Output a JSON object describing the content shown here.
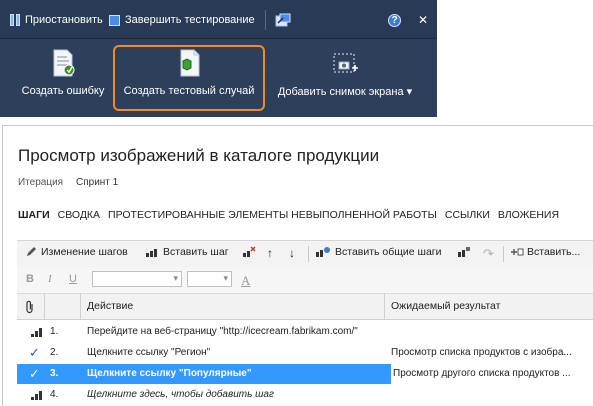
{
  "runner": {
    "pause_label": "Приостановить",
    "end_label": "Завершить тестирование",
    "help_glyph": "?",
    "close_glyph": "✕",
    "buttons": {
      "create_bug": "Создать ошибку",
      "create_test_case": "Создать тестовый случай",
      "add_screenshot": "Добавить снимок экрана ▾"
    },
    "accent_color": "#f08c1e"
  },
  "test_case": {
    "title": "Просмотр изображений в каталоге продукции",
    "iteration_label": "Итерация",
    "iteration_value": "Спринт 1",
    "tabs": [
      "ШАГИ",
      "СВОДКА",
      "ПРОТЕСТИРОВАННЫЕ ЭЛЕМЕНТЫ НЕВЫПОЛНЕННОЙ РАБОТЫ",
      "ССЫЛКИ",
      "ВЛОЖЕНИЯ"
    ]
  },
  "steps_toolbar": {
    "edit_steps": "Изменение шагов",
    "insert_step": "Вставить шаг",
    "insert_shared": "Вставить общие шаги",
    "insert_more": "Вставить..."
  },
  "format_toolbar": {
    "bold": "B",
    "italic": "I",
    "underline": "U",
    "font_color": "A"
  },
  "grid": {
    "columns": {
      "action": "Действие",
      "expected": "Ожидаемый результат"
    },
    "rows": [
      {
        "num": "1.",
        "action": "Перейдите на веб-страницу \"http://icecream.fabrikam.com/\"",
        "expected": ""
      },
      {
        "num": "2.",
        "action": "Щелкните ссылку \"Регион\"",
        "expected": "Просмотр списка продуктов с изобра..."
      },
      {
        "num": "3.",
        "action": "Щелкните ссылку \"Популярные\"",
        "expected": "Просмотр другого списка продуктов ..."
      },
      {
        "num": "4.",
        "action": "Щелкните здесь, чтобы добавить шаг",
        "expected": ""
      }
    ]
  }
}
